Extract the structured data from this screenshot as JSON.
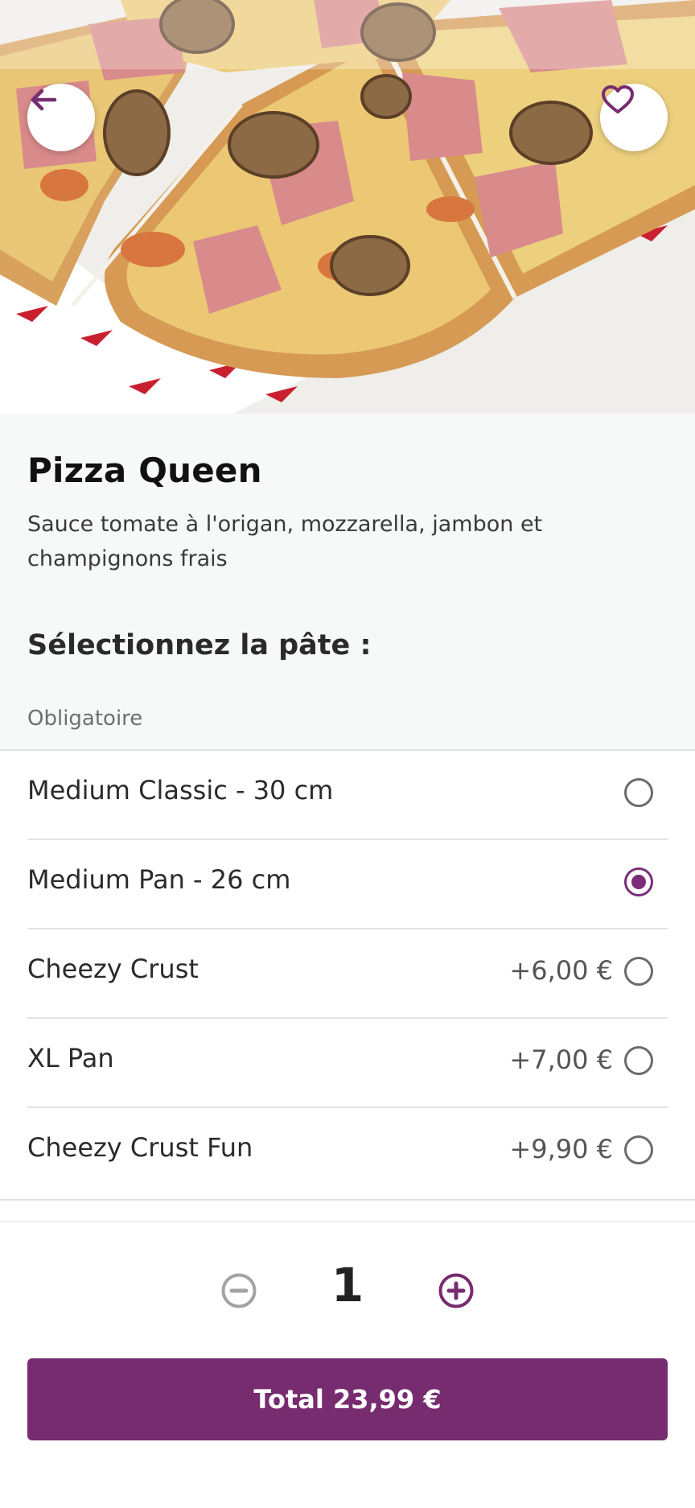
{
  "colors": {
    "accent": "#772c6f",
    "background": "#f7f8f8"
  },
  "hero": {
    "image": "pizza-photo",
    "back_icon": "arrow-left-icon",
    "favorite_icon": "heart-outline-icon"
  },
  "product": {
    "title": "Pizza Queen",
    "description": "Sauce tomate à l'origan, mozzarella, jambon et champignons frais"
  },
  "crust_section": {
    "title": "Sélectionnez la pâte :",
    "required_label": "Obligatoire",
    "options": [
      {
        "label": "Medium Classic - 30 cm",
        "price": "",
        "selected": false
      },
      {
        "label": "Medium Pan - 26 cm",
        "price": "",
        "selected": true
      },
      {
        "label": "Cheezy Crust",
        "price": "+6,00 €",
        "selected": false
      },
      {
        "label": "XL Pan",
        "price": "+7,00 €",
        "selected": false
      },
      {
        "label": "Cheezy Crust Fun",
        "price": "+9,90 €",
        "selected": false
      }
    ]
  },
  "quantity": {
    "value": "1",
    "minus_icon": "minus-circle-icon",
    "plus_icon": "plus-circle-icon"
  },
  "total_button": {
    "label": "Total 23,99 €"
  }
}
